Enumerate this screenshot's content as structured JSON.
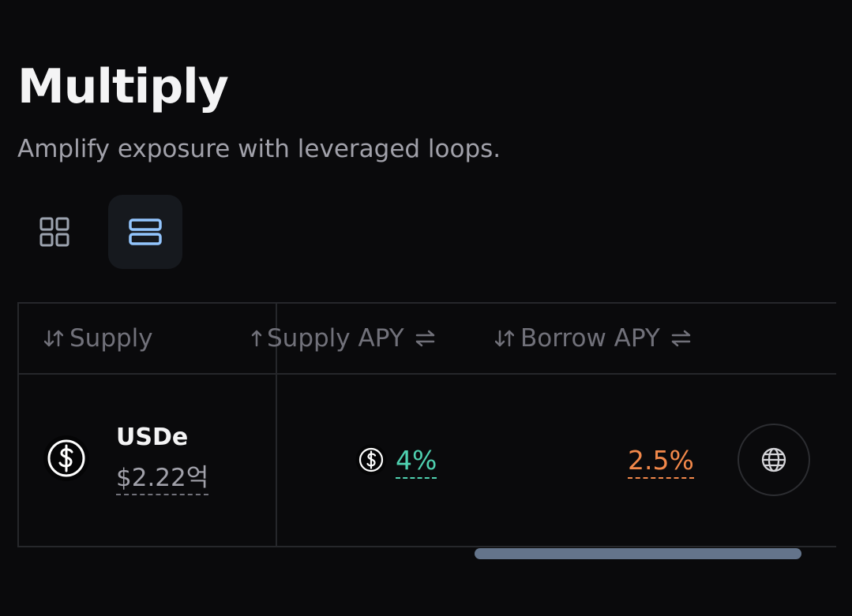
{
  "header": {
    "title": "Multiply",
    "subtitle": "Amplify exposure with leveraged loops."
  },
  "view_toggle": {
    "options": [
      {
        "icon": "grid-view-icon",
        "active": false
      },
      {
        "icon": "list-view-icon",
        "active": true
      }
    ]
  },
  "table": {
    "columns": {
      "supply": "Supply",
      "supply_apy": "Supply APY",
      "borrow_apy": "Borrow APY"
    },
    "rows": [
      {
        "asset": "USDe",
        "value": "$2.22억",
        "asset_icon": "dollar-coin-icon",
        "supply_apy": "4%",
        "borrow_apy": "2.5%",
        "action_icon": "globe-icon"
      }
    ]
  },
  "colors": {
    "background": "#0a0a0c",
    "supply_apy": "#4fd1b0",
    "borrow_apy": "#f2884a",
    "active_icon": "#93c5fd",
    "scrollbar": "#64748b"
  }
}
